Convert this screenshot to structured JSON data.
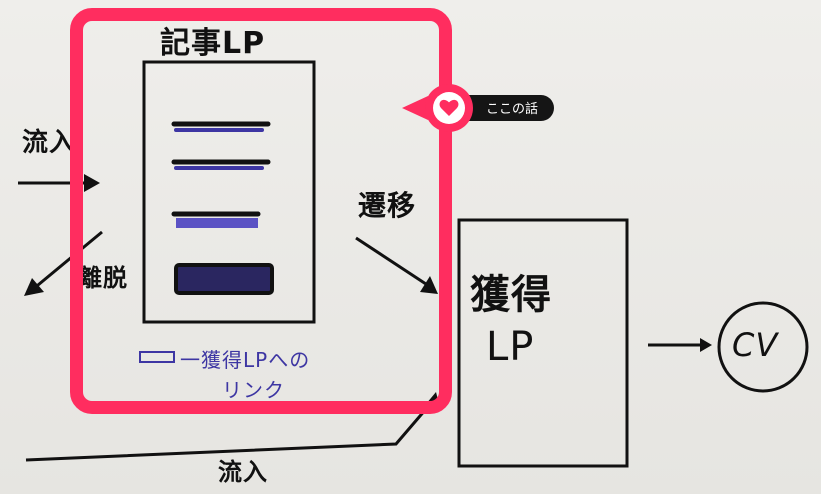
{
  "diagram": {
    "article_lp_label": "記事LP",
    "acquisition_lp_label_1": "獲得",
    "acquisition_lp_label_2": "LP",
    "cv_label": "CV",
    "inflow_label": "流入",
    "exit_label": "離脱",
    "transition_label": "遷移",
    "bottom_inflow_label": "流入",
    "link_note_line1": "一獲得LPへの",
    "link_note_line2": "リンク"
  },
  "badge": {
    "label": "ここの話",
    "icon": "heart-icon"
  },
  "colors": {
    "highlight": "#ff2d5f",
    "ink": "#111111",
    "blue_ink": "#3d36a3",
    "badge_bg": "#151515"
  }
}
